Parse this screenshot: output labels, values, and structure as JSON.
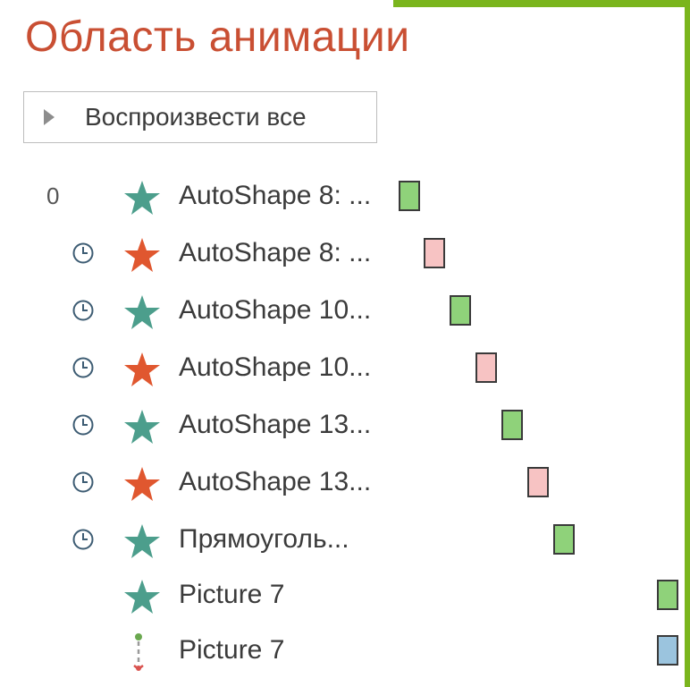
{
  "pane": {
    "title": "Область анимации",
    "play_all_label": "Воспроизвести все"
  },
  "colors": {
    "title": "#c94f33",
    "entrance_star": "#4c9e8c",
    "emphasis_star": "#e0572f",
    "bar_green": "#8fd27a",
    "bar_pink": "#f7c3c3",
    "bar_blue": "#9bc4de",
    "slide_accent": "#7ab51d"
  },
  "items": [
    {
      "number": "0",
      "trigger": "on-click",
      "effect": "entrance-star",
      "name": "AutoShape 8: ...",
      "bar_color": "green"
    },
    {
      "number": "",
      "trigger": "after-previous",
      "effect": "emphasis-star",
      "name": "AutoShape 8: ...",
      "bar_color": "pink"
    },
    {
      "number": "",
      "trigger": "after-previous",
      "effect": "entrance-star",
      "name": "AutoShape 10...",
      "bar_color": "green"
    },
    {
      "number": "",
      "trigger": "after-previous",
      "effect": "emphasis-star",
      "name": "AutoShape 10...",
      "bar_color": "pink"
    },
    {
      "number": "",
      "trigger": "after-previous",
      "effect": "entrance-star",
      "name": "AutoShape 13...",
      "bar_color": "green"
    },
    {
      "number": "",
      "trigger": "after-previous",
      "effect": "emphasis-star",
      "name": "AutoShape 13...",
      "bar_color": "pink"
    },
    {
      "number": "",
      "trigger": "after-previous",
      "effect": "entrance-star",
      "name": "Прямоуголь...",
      "bar_color": "green"
    },
    {
      "number": "",
      "trigger": "with-previous",
      "effect": "entrance-star",
      "name": "Picture 7",
      "bar_color": "green"
    },
    {
      "number": "",
      "trigger": "with-previous",
      "effect": "motion-path",
      "name": "Picture 7",
      "bar_color": "blue"
    }
  ]
}
